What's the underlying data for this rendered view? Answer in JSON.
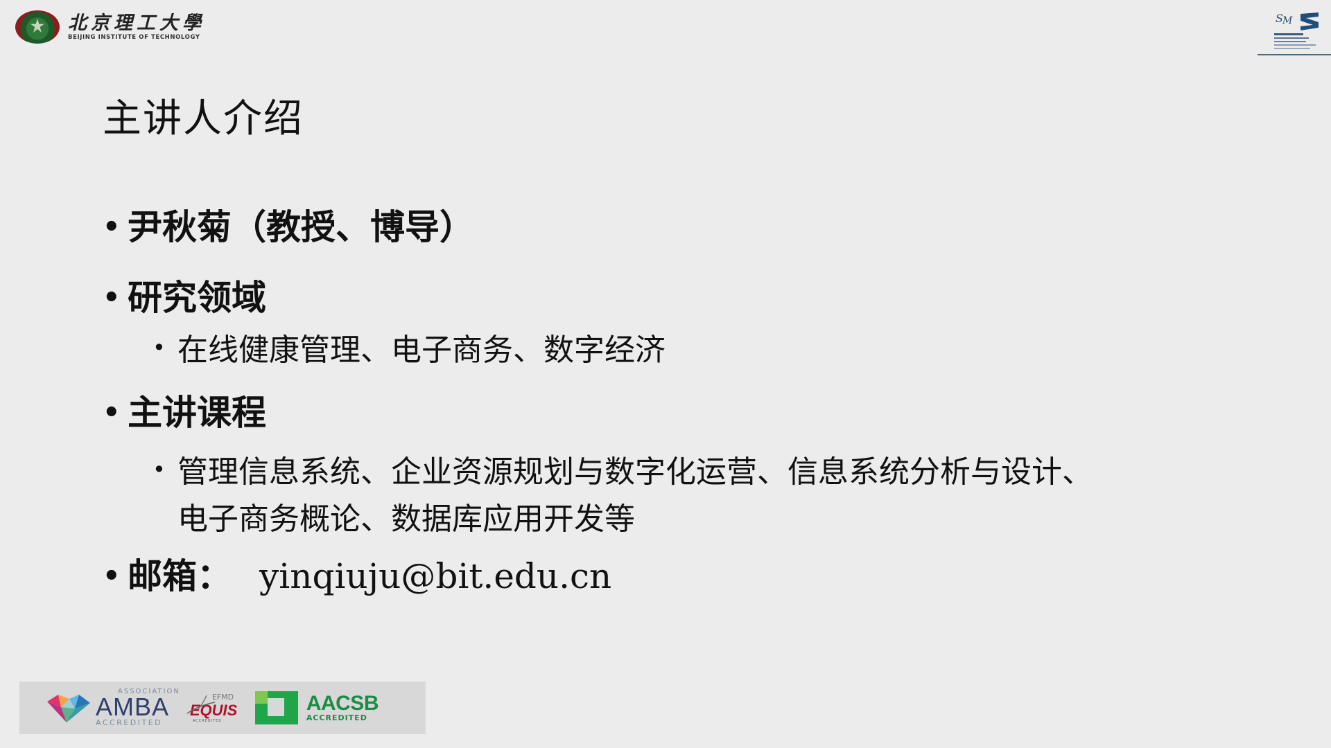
{
  "header": {
    "university_cn": "北京理工大學",
    "university_en": "BEIJING INSTITUTE OF TECHNOLOGY",
    "university_emblem": "bit-emblem-icon",
    "school_logo": "sme-logo-icon"
  },
  "slide": {
    "title": "主讲人介绍",
    "bullets": [
      {
        "label": "尹秋菊（教授、博导）",
        "sub": []
      },
      {
        "label": "研究领域",
        "sub": [
          "在线健康管理、电子商务、数字经济"
        ]
      },
      {
        "label": "主讲课程",
        "sub": [
          "管理信息系统、企业资源规划与数字化运营、信息系统分析与设计、",
          "电子商务概论、数据库应用开发等"
        ]
      },
      {
        "label": "邮箱：",
        "value": "yinqiuju@bit.edu.cn"
      }
    ]
  },
  "accreditations": {
    "amba_assoc": "ASSOCIATION",
    "amba": "AMBA",
    "amba_acc": "ACCREDITED",
    "equis_efmd": "EFMD",
    "equis": "EQUIS",
    "equis_acc": "ACCREDITED",
    "aacsb": "AACSB",
    "aacsb_acc": "ACCREDITED"
  },
  "colors": {
    "background": "#ececec",
    "text": "#111111",
    "amba_blue": "#2f3e6a",
    "equis_red": "#b0122a",
    "aacsb_green": "#1a8c44"
  }
}
